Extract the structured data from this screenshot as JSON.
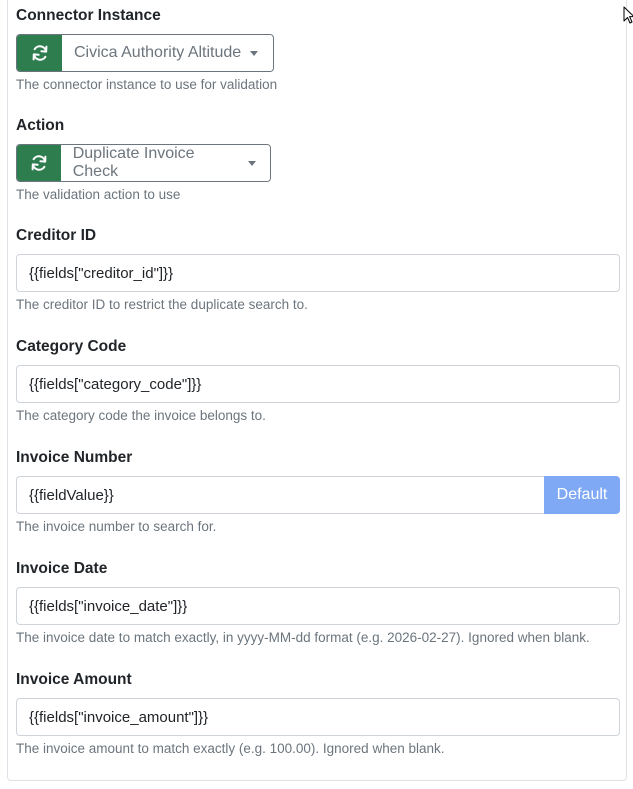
{
  "connector": {
    "label": "Connector Instance",
    "value": "Civica Authority Altitude",
    "help": "The connector instance to use for validation"
  },
  "action": {
    "label": "Action",
    "value": "Duplicate Invoice Check",
    "help": "The validation action to use"
  },
  "creditor_id": {
    "label": "Creditor ID",
    "value": "{{fields[\"creditor_id\"]}}",
    "help": "The creditor ID to restrict the duplicate search to."
  },
  "category_code": {
    "label": "Category Code",
    "value": "{{fields[\"category_code\"]}}",
    "help": "The category code the invoice belongs to."
  },
  "invoice_number": {
    "label": "Invoice Number",
    "value": "{{fieldValue}}",
    "default_label": "Default",
    "help": "The invoice number to search for."
  },
  "invoice_date": {
    "label": "Invoice Date",
    "value": "{{fields[\"invoice_date\"]}}",
    "help": "The invoice date to match exactly, in yyyy-MM-dd format (e.g. 2026-02-27). Ignored when blank."
  },
  "invoice_amount": {
    "label": "Invoice Amount",
    "value": "{{fields[\"invoice_amount\"]}}",
    "help": "The invoice amount to match exactly (e.g. 100.00). Ignored when blank."
  },
  "colors": {
    "refresh_button": "#2e7d4f",
    "default_button": "#80a9f5"
  },
  "icons": [
    "refresh-icon",
    "chevron-down-icon",
    "mouse-cursor-icon"
  ]
}
